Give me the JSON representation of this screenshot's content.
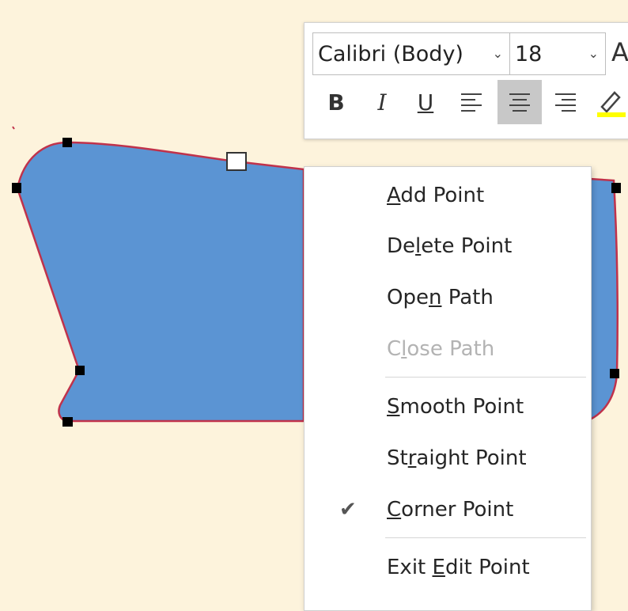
{
  "toolbar": {
    "font_name": "Calibri (Body)",
    "font_size": "18",
    "bold_label": "B",
    "italic_label": "I",
    "underline_label": "U",
    "highlight_color": "#ffff00"
  },
  "shape": {
    "fill_color": "#5b94d3",
    "outline_color": "#c0324b"
  },
  "context_menu": {
    "items": [
      {
        "pre": "",
        "key": "A",
        "post": "dd Point",
        "enabled": true,
        "checked": false
      },
      {
        "pre": "De",
        "key": "l",
        "post": "ete Point",
        "enabled": true,
        "checked": false
      },
      {
        "pre": "Ope",
        "key": "n",
        "post": " Path",
        "enabled": true,
        "checked": false
      },
      {
        "pre": "C",
        "key": "l",
        "post": "ose Path",
        "enabled": false,
        "checked": false
      },
      {
        "pre": "",
        "key": "S",
        "post": "mooth Point",
        "enabled": true,
        "checked": false
      },
      {
        "pre": "St",
        "key": "r",
        "post": "aight Point",
        "enabled": true,
        "checked": false
      },
      {
        "pre": "",
        "key": "C",
        "post": "orner Point",
        "enabled": true,
        "checked": true
      },
      {
        "pre": "Exit ",
        "key": "E",
        "post": "dit Point",
        "enabled": true,
        "checked": false
      }
    ],
    "check_glyph": "✔"
  }
}
